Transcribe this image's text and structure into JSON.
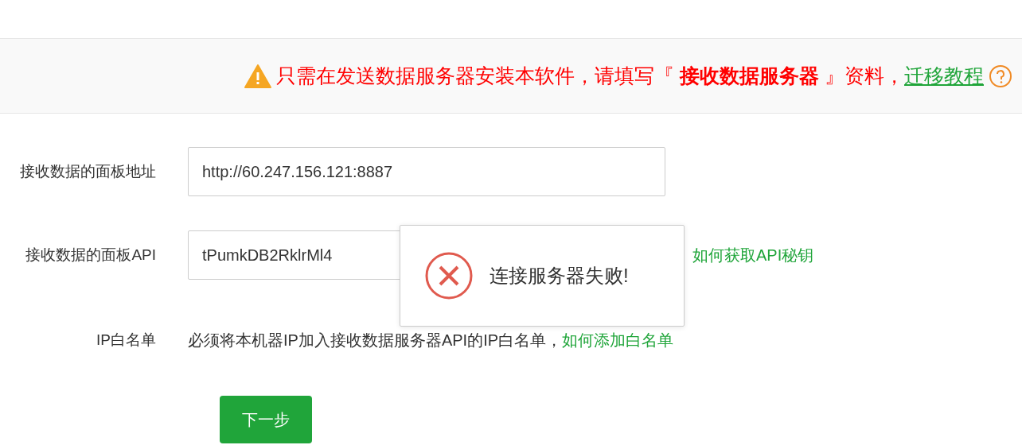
{
  "notice": {
    "text": "只需在发送数据服务器安装本软件，请填写『 **接收数据服务器** 』资料，",
    "link": "迁移教程"
  },
  "form": {
    "rows": [
      {
        "kind": "input",
        "label": "接收数据的面板地址",
        "value": "http://60.247.156.121:8887"
      },
      {
        "kind": "input",
        "label": "接收数据的面板API",
        "value": "tPumkDB2RklrMl4",
        "link": "如何获取API秘钥"
      },
      {
        "kind": "text",
        "label": "IP白名单",
        "text": "必须将本机器IP加入接收数据服务器API的IP白名单，",
        "link": "如何添加白名单"
      }
    ],
    "button": "下一步"
  },
  "toast": {
    "kind": "error",
    "message": "连接服务器失败!"
  }
}
